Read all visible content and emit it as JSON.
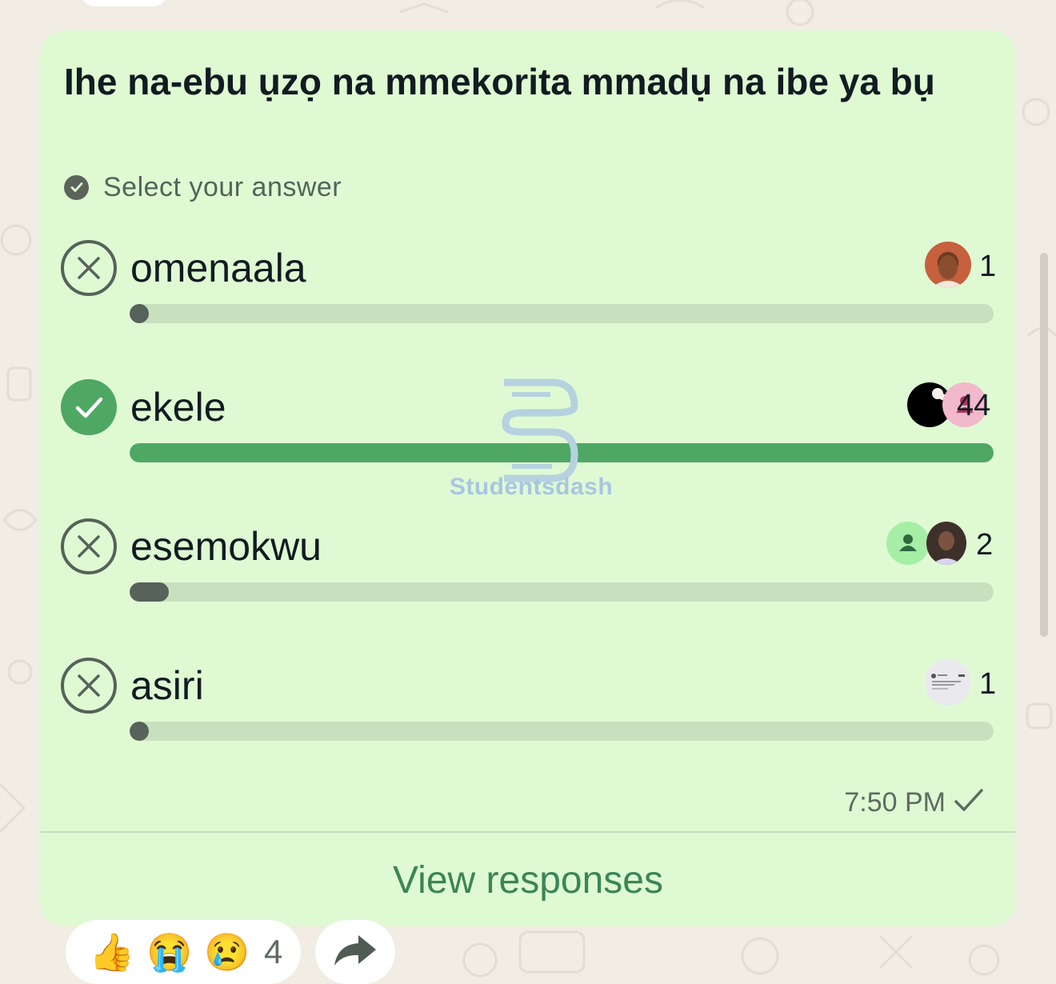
{
  "poll": {
    "question": "Ihe na-ebu ụzọ na mmekorita mmadụ na ibe ya bụ",
    "instruction": "Select your answer",
    "options": [
      {
        "label": "omenaala",
        "votes": "1",
        "fill": 0.02,
        "status": "wrong"
      },
      {
        "label": "ekele",
        "votes": "44",
        "fill": 1.0,
        "status": "correct"
      },
      {
        "label": "esemokwu",
        "votes": "2",
        "fill": 0.045,
        "status": "wrong"
      },
      {
        "label": "asiri",
        "votes": "1",
        "fill": 0.02,
        "status": "wrong"
      }
    ],
    "time": "7:50 PM",
    "view_responses": "View responses"
  },
  "watermark": {
    "text": "Studentsdash"
  },
  "reactions": {
    "emojis": [
      "👍",
      "😭",
      "😢"
    ],
    "count": "4"
  },
  "colors": {
    "bubble": "#dffad3",
    "correct": "#4fa764",
    "bar_track": "#c9e0bf",
    "bar_dot": "#56625a",
    "link": "#3b8556"
  },
  "icons": {
    "wrong": "x-circle-icon",
    "correct": "check-circle-icon",
    "instruction": "check-badge-icon",
    "read": "single-tick-icon",
    "forward": "forward-arrow-icon"
  }
}
